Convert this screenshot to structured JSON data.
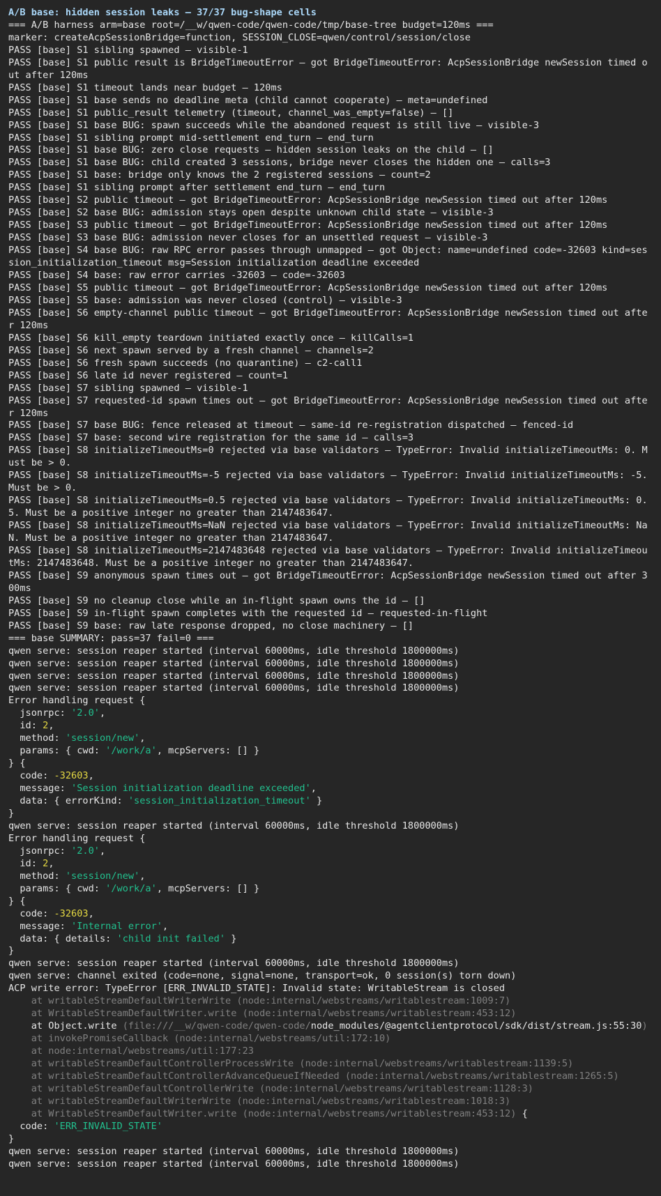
{
  "colors": {
    "background": "#262626",
    "text": "#e6e6e6",
    "heading": "#a9d6f7",
    "string": "#22c18f",
    "number": "#e5d943",
    "dim": "#808080"
  },
  "terminal": {
    "lines": [
      {
        "style": "heading",
        "color": "#a9d6f7",
        "segs": [
          {
            "t": "A/B base: hidden session leaks — 37/37 bug-shape cells"
          }
        ]
      },
      {
        "segs": [
          {
            "t": "=== A/B harness arm=base root=/__w/qwen-code/qwen-code/tmp/base-tree budget=120ms ==="
          }
        ]
      },
      {
        "segs": [
          {
            "t": "marker: createAcpSessionBridge=function, SESSION_CLOSE=qwen/control/session/close"
          }
        ]
      },
      {
        "segs": [
          {
            "t": "PASS [base] S1 sibling spawned — visible-1"
          }
        ]
      },
      {
        "segs": [
          {
            "t": "PASS [base] S1 public result is BridgeTimeoutError — got BridgeTimeoutError: AcpSessionBridge newSession timed out after 120ms"
          }
        ]
      },
      {
        "segs": [
          {
            "t": "PASS [base] S1 timeout lands near budget — 120ms"
          }
        ]
      },
      {
        "segs": [
          {
            "t": "PASS [base] S1 base sends no deadline meta (child cannot cooperate) — meta=undefined"
          }
        ]
      },
      {
        "segs": [
          {
            "t": "PASS [base] S1 public_result telemetry (timeout, channel_was_empty=false) — []"
          }
        ]
      },
      {
        "segs": [
          {
            "t": "PASS [base] S1 base BUG: spawn succeeds while the abandoned request is still live — visible-3"
          }
        ]
      },
      {
        "segs": [
          {
            "t": "PASS [base] S1 sibling prompt mid-settlement end_turn — end_turn"
          }
        ]
      },
      {
        "segs": [
          {
            "t": "PASS [base] S1 base BUG: zero close requests — hidden session leaks on the child — []"
          }
        ]
      },
      {
        "segs": [
          {
            "t": "PASS [base] S1 base BUG: child created 3 sessions, bridge never closes the hidden one — calls=3"
          }
        ]
      },
      {
        "segs": [
          {
            "t": "PASS [base] S1 base: bridge only knows the 2 registered sessions — count=2"
          }
        ]
      },
      {
        "segs": [
          {
            "t": "PASS [base] S1 sibling prompt after settlement end_turn — end_turn"
          }
        ]
      },
      {
        "segs": [
          {
            "t": "PASS [base] S2 public timeout — got BridgeTimeoutError: AcpSessionBridge newSession timed out after 120ms"
          }
        ]
      },
      {
        "segs": [
          {
            "t": "PASS [base] S2 base BUG: admission stays open despite unknown child state — visible-3"
          }
        ]
      },
      {
        "segs": [
          {
            "t": "PASS [base] S3 public timeout — got BridgeTimeoutError: AcpSessionBridge newSession timed out after 120ms"
          }
        ]
      },
      {
        "segs": [
          {
            "t": "PASS [base] S3 base BUG: admission never closes for an unsettled request — visible-3"
          }
        ]
      },
      {
        "segs": [
          {
            "t": "PASS [base] S4 base BUG: raw RPC error passes through unmapped — got Object: name=undefined code=-32603 kind=session_initialization_timeout msg=Session initialization deadline exceeded"
          }
        ]
      },
      {
        "segs": [
          {
            "t": "PASS [base] S4 base: raw error carries -32603 — code=-32603"
          }
        ]
      },
      {
        "segs": [
          {
            "t": "PASS [base] S5 public timeout — got BridgeTimeoutError: AcpSessionBridge newSession timed out after 120ms"
          }
        ]
      },
      {
        "segs": [
          {
            "t": "PASS [base] S5 base: admission was never closed (control) — visible-3"
          }
        ]
      },
      {
        "segs": [
          {
            "t": "PASS [base] S6 empty-channel public timeout — got BridgeTimeoutError: AcpSessionBridge newSession timed out after 120ms"
          }
        ]
      },
      {
        "segs": [
          {
            "t": "PASS [base] S6 kill_empty teardown initiated exactly once — killCalls=1"
          }
        ]
      },
      {
        "segs": [
          {
            "t": "PASS [base] S6 next spawn served by a fresh channel — channels=2"
          }
        ]
      },
      {
        "segs": [
          {
            "t": "PASS [base] S6 fresh spawn succeeds (no quarantine) — c2-call1"
          }
        ]
      },
      {
        "segs": [
          {
            "t": "PASS [base] S6 late id never registered — count=1"
          }
        ]
      },
      {
        "segs": [
          {
            "t": "PASS [base] S7 sibling spawned — visible-1"
          }
        ]
      },
      {
        "segs": [
          {
            "t": "PASS [base] S7 requested-id spawn times out — got BridgeTimeoutError: AcpSessionBridge newSession timed out after 120ms"
          }
        ]
      },
      {
        "segs": [
          {
            "t": "PASS [base] S7 base BUG: fence released at timeout — same-id re-registration dispatched — fenced-id"
          }
        ]
      },
      {
        "segs": [
          {
            "t": "PASS [base] S7 base: second wire registration for the same id — calls=3"
          }
        ]
      },
      {
        "segs": [
          {
            "t": "PASS [base] S8 initializeTimeoutMs=0 rejected via base validators — TypeError: Invalid initializeTimeoutMs: 0. Must be > 0."
          }
        ]
      },
      {
        "segs": [
          {
            "t": "PASS [base] S8 initializeTimeoutMs=-5 rejected via base validators — TypeError: Invalid initializeTimeoutMs: -5. Must be > 0."
          }
        ]
      },
      {
        "segs": [
          {
            "t": "PASS [base] S8 initializeTimeoutMs=0.5 rejected via base validators — TypeError: Invalid initializeTimeoutMs: 0.5. Must be a positive integer no greater than 2147483647."
          }
        ]
      },
      {
        "segs": [
          {
            "t": "PASS [base] S8 initializeTimeoutMs=NaN rejected via base validators — TypeError: Invalid initializeTimeoutMs: NaN. Must be a positive integer no greater than 2147483647."
          }
        ]
      },
      {
        "segs": [
          {
            "t": "PASS [base] S8 initializeTimeoutMs=2147483648 rejected via base validators — TypeError: Invalid initializeTimeoutMs: 2147483648. Must be a positive integer no greater than 2147483647."
          }
        ]
      },
      {
        "segs": [
          {
            "t": "PASS [base] S9 anonymous spawn times out — got BridgeTimeoutError: AcpSessionBridge newSession timed out after 300ms"
          }
        ]
      },
      {
        "segs": [
          {
            "t": "PASS [base] S9 no cleanup close while an in-flight spawn owns the id — []"
          }
        ]
      },
      {
        "segs": [
          {
            "t": "PASS [base] S9 in-flight spawn completes with the requested id — requested-in-flight"
          }
        ]
      },
      {
        "segs": [
          {
            "t": "PASS [base] S9 base: raw late response dropped, no close machinery — []"
          }
        ]
      },
      {
        "segs": [
          {
            "t": "=== base SUMMARY: pass=37 fail=0 ==="
          }
        ]
      },
      {
        "segs": [
          {
            "t": "qwen serve: session reaper started (interval 60000ms, idle threshold 1800000ms)"
          }
        ]
      },
      {
        "segs": [
          {
            "t": "qwen serve: session reaper started (interval 60000ms, idle threshold 1800000ms)"
          }
        ]
      },
      {
        "segs": [
          {
            "t": "qwen serve: session reaper started (interval 60000ms, idle threshold 1800000ms)"
          }
        ]
      },
      {
        "segs": [
          {
            "t": "qwen serve: session reaper started (interval 60000ms, idle threshold 1800000ms)"
          }
        ]
      },
      {
        "segs": [
          {
            "t": "Error handling request {"
          }
        ]
      },
      {
        "segs": [
          {
            "t": "  jsonrpc: "
          },
          {
            "t": "'2.0'",
            "c": "s"
          },
          {
            "t": ","
          }
        ]
      },
      {
        "segs": [
          {
            "t": "  id: "
          },
          {
            "t": "2",
            "c": "n"
          },
          {
            "t": ","
          }
        ]
      },
      {
        "segs": [
          {
            "t": "  method: "
          },
          {
            "t": "'session/new'",
            "c": "s"
          },
          {
            "t": ","
          }
        ]
      },
      {
        "segs": [
          {
            "t": "  params: { cwd: "
          },
          {
            "t": "'/work/a'",
            "c": "s"
          },
          {
            "t": ", mcpServers: [] }"
          }
        ]
      },
      {
        "segs": [
          {
            "t": "} {"
          }
        ]
      },
      {
        "segs": [
          {
            "t": "  code: "
          },
          {
            "t": "-32603",
            "c": "n"
          },
          {
            "t": ","
          }
        ]
      },
      {
        "segs": [
          {
            "t": "  message: "
          },
          {
            "t": "'Session initialization deadline exceeded'",
            "c": "s"
          },
          {
            "t": ","
          }
        ]
      },
      {
        "segs": [
          {
            "t": "  data: { errorKind: "
          },
          {
            "t": "'session_initialization_timeout'",
            "c": "s"
          },
          {
            "t": " }"
          }
        ]
      },
      {
        "segs": [
          {
            "t": "}"
          }
        ]
      },
      {
        "segs": [
          {
            "t": "qwen serve: session reaper started (interval 60000ms, idle threshold 1800000ms)"
          }
        ]
      },
      {
        "segs": [
          {
            "t": "Error handling request {"
          }
        ]
      },
      {
        "segs": [
          {
            "t": "  jsonrpc: "
          },
          {
            "t": "'2.0'",
            "c": "s"
          },
          {
            "t": ","
          }
        ]
      },
      {
        "segs": [
          {
            "t": "  id: "
          },
          {
            "t": "2",
            "c": "n"
          },
          {
            "t": ","
          }
        ]
      },
      {
        "segs": [
          {
            "t": "  method: "
          },
          {
            "t": "'session/new'",
            "c": "s"
          },
          {
            "t": ","
          }
        ]
      },
      {
        "segs": [
          {
            "t": "  params: { cwd: "
          },
          {
            "t": "'/work/a'",
            "c": "s"
          },
          {
            "t": ", mcpServers: [] }"
          }
        ]
      },
      {
        "segs": [
          {
            "t": "} {"
          }
        ]
      },
      {
        "segs": [
          {
            "t": "  code: "
          },
          {
            "t": "-32603",
            "c": "n"
          },
          {
            "t": ","
          }
        ]
      },
      {
        "segs": [
          {
            "t": "  message: "
          },
          {
            "t": "'Internal error'",
            "c": "s"
          },
          {
            "t": ","
          }
        ]
      },
      {
        "segs": [
          {
            "t": "  data: { details: "
          },
          {
            "t": "'child init failed'",
            "c": "s"
          },
          {
            "t": " }"
          }
        ]
      },
      {
        "segs": [
          {
            "t": "}"
          }
        ]
      },
      {
        "segs": [
          {
            "t": "qwen serve: session reaper started (interval 60000ms, idle threshold 1800000ms)"
          }
        ]
      },
      {
        "segs": [
          {
            "t": "qwen serve: channel exited (code=none, signal=none, transport=ok, 0 session(s) torn down)"
          }
        ]
      },
      {
        "segs": [
          {
            "t": "ACP write error: TypeError [ERR_INVALID_STATE]: Invalid state: WritableStream is closed"
          }
        ]
      },
      {
        "segs": [
          {
            "t": "    at writableStreamDefaultWriterWrite (node:internal/webstreams/writablestream:1009:7)",
            "c": "dim"
          }
        ]
      },
      {
        "segs": [
          {
            "t": "    at WritableStreamDefaultWriter.write (node:internal/webstreams/writablestream:453:12)",
            "c": "dim"
          }
        ]
      },
      {
        "segs": [
          {
            "t": "    at Object.write "
          },
          {
            "t": "(file:///__w/qwen-code/qwen-code/",
            "c": "dim"
          },
          {
            "t": "node_modules/@agentclientprotocol/sdk/dist/stream.js:55:30"
          },
          {
            "t": ")",
            "c": "dim"
          }
        ]
      },
      {
        "segs": [
          {
            "t": "    at invokePromiseCallback (node:internal/webstreams/util:172:10)",
            "c": "dim"
          }
        ]
      },
      {
        "segs": [
          {
            "t": "    at node:internal/webstreams/util:177:23",
            "c": "dim"
          }
        ]
      },
      {
        "segs": [
          {
            "t": "    at writableStreamDefaultControllerProcessWrite (node:internal/webstreams/writablestream:1139:5)",
            "c": "dim"
          }
        ]
      },
      {
        "segs": [
          {
            "t": "    at writableStreamDefaultControllerAdvanceQueueIfNeeded (node:internal/webstreams/writablestream:1265:5)",
            "c": "dim"
          }
        ]
      },
      {
        "segs": [
          {
            "t": "    at writableStreamDefaultControllerWrite (node:internal/webstreams/writablestream:1128:3)",
            "c": "dim"
          }
        ]
      },
      {
        "segs": [
          {
            "t": "    at writableStreamDefaultWriterWrite (node:internal/webstreams/writablestream:1018:3)",
            "c": "dim"
          }
        ]
      },
      {
        "segs": [
          {
            "t": "    at WritableStreamDefaultWriter.write (node:internal/webstreams/writablestream:453:12)",
            "c": "dim"
          },
          {
            "t": " {"
          }
        ]
      },
      {
        "segs": [
          {
            "t": "  code: "
          },
          {
            "t": "'ERR_INVALID_STATE'",
            "c": "s"
          }
        ]
      },
      {
        "segs": [
          {
            "t": "}"
          }
        ]
      },
      {
        "segs": [
          {
            "t": "qwen serve: session reaper started (interval 60000ms, idle threshold 1800000ms)"
          }
        ]
      },
      {
        "segs": [
          {
            "t": "qwen serve: session reaper started (interval 60000ms, idle threshold 1800000ms)"
          }
        ]
      }
    ]
  }
}
